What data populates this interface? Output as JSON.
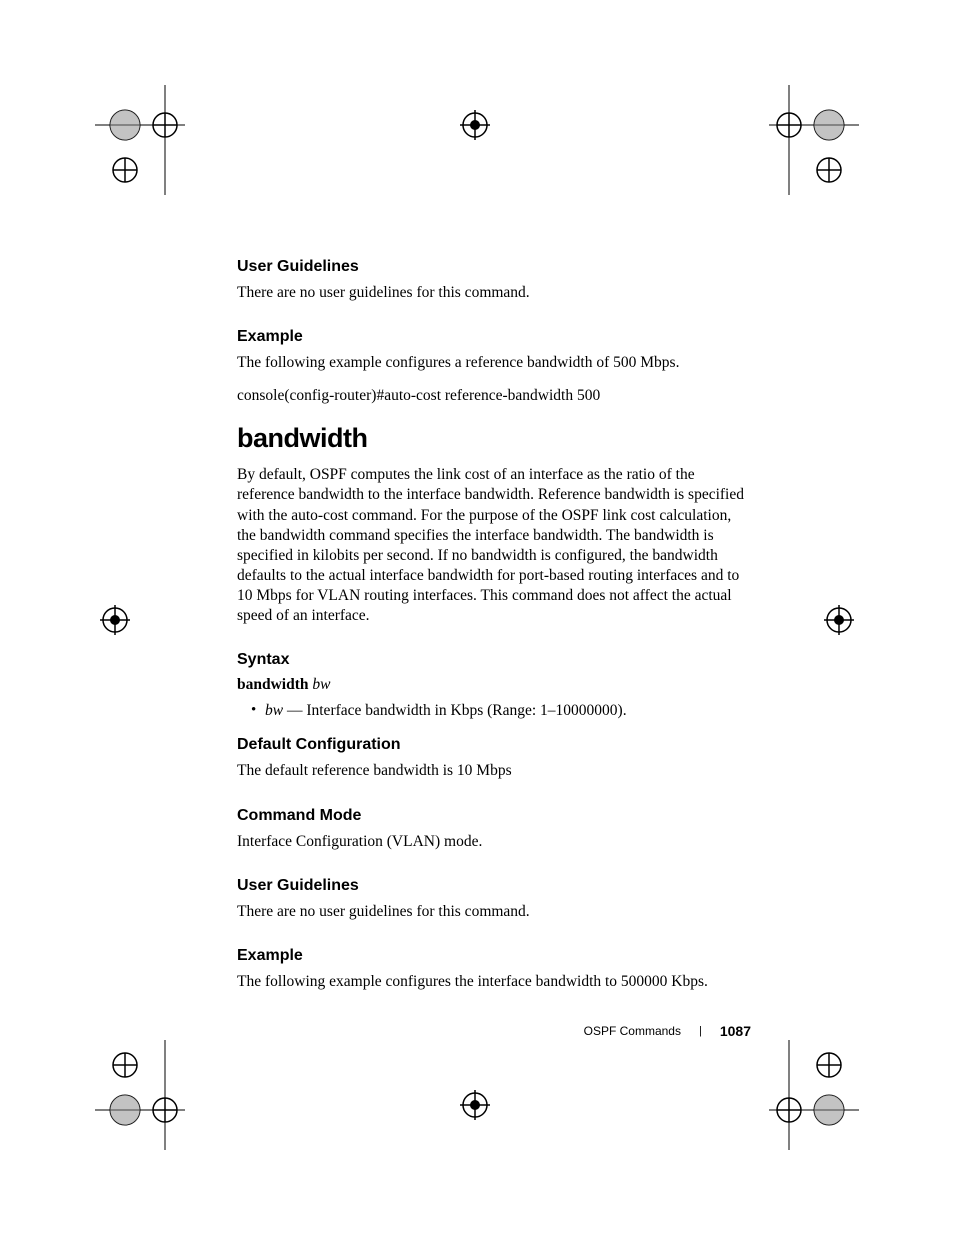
{
  "sections": {
    "userGuidelines1": {
      "heading": "User Guidelines",
      "text": "There are no user guidelines for this command."
    },
    "example1": {
      "heading": "Example",
      "text": "The following example configures a reference bandwidth of 500 Mbps.",
      "code": "console(config-router)#auto-cost reference-bandwidth 500"
    },
    "bandwidth": {
      "title": "bandwidth",
      "description": "By default, OSPF computes the link cost of an interface as the ratio of the reference bandwidth to the interface bandwidth. Reference bandwidth is specified with the auto-cost command. For the purpose of the OSPF link cost calculation, the bandwidth command specifies the interface bandwidth. The bandwidth is specified in kilobits per second. If no bandwidth is configured, the bandwidth defaults to the actual interface bandwidth for port-based routing interfaces and to 10 Mbps for VLAN routing interfaces. This command does not affect the actual speed of an interface."
    },
    "syntax": {
      "heading": "Syntax",
      "commandBold": "bandwidth",
      "commandItalic": "bw",
      "bulletItalic": "bw",
      "bulletText": " — Interface bandwidth in Kbps (Range: 1–10000000)."
    },
    "defaultConfig": {
      "heading": "Default Configuration",
      "text": "The default reference bandwidth is 10 Mbps"
    },
    "commandMode": {
      "heading": "Command Mode",
      "text": "Interface Configuration (VLAN) mode."
    },
    "userGuidelines2": {
      "heading": "User Guidelines",
      "text": "There are no user guidelines for this command."
    },
    "example2": {
      "heading": "Example",
      "text": "The following example configures the interface bandwidth to 500000 Kbps."
    }
  },
  "footer": {
    "section": "OSPF Commands",
    "page": "1087"
  }
}
